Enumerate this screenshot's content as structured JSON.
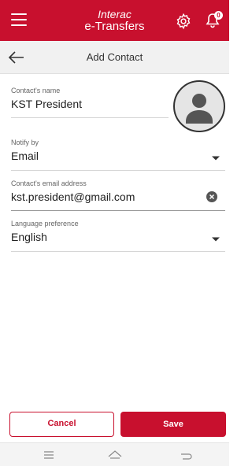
{
  "header": {
    "title_line1": "Interac",
    "title_line2": "e-Transfers",
    "notification_count": "0",
    "brand_color": "#c8102e"
  },
  "subheader": {
    "title": "Add Contact"
  },
  "form": {
    "name": {
      "label": "Contact's name",
      "value": "KST President"
    },
    "notify": {
      "label": "Notify by",
      "value": "Email"
    },
    "email": {
      "label": "Contact's email address",
      "value": "kst.president@gmail.com"
    },
    "language": {
      "label": "Language preference",
      "value": "English"
    }
  },
  "actions": {
    "cancel_label": "Cancel",
    "save_label": "Save"
  },
  "icons": {
    "menu": "hamburger-menu-icon",
    "settings": "gear-icon",
    "notifications": "bell-icon",
    "back": "back-arrow-icon",
    "avatar": "person-avatar-icon",
    "clear": "clear-icon",
    "dropdown": "chevron-down-icon"
  }
}
